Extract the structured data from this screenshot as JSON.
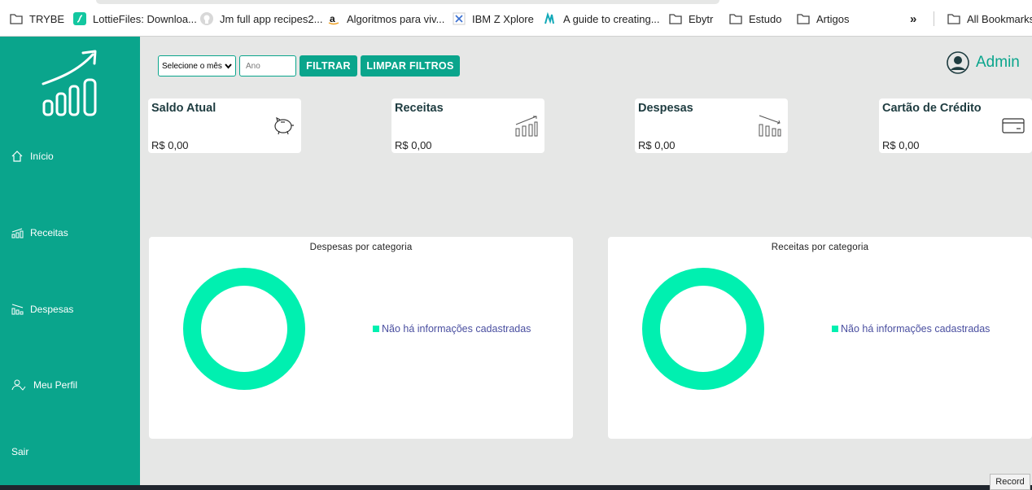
{
  "bookmarks": {
    "items": [
      {
        "label": "TRYBE",
        "icon": "folder-icon"
      },
      {
        "label": "LottieFiles: Downloa...",
        "icon": "lottiefiles-icon"
      },
      {
        "label": "Jm full app recipes2...",
        "icon": "github-icon"
      },
      {
        "label": "Algoritmos para viv...",
        "icon": "amazon-icon"
      },
      {
        "label": "IBM Z Xplore",
        "icon": "ibm-icon"
      },
      {
        "label": "A guide to creating...",
        "icon": "medium-icon"
      },
      {
        "label": "Ebytr",
        "icon": "folder-icon"
      },
      {
        "label": "Estudo",
        "icon": "folder-icon"
      },
      {
        "label": "Artigos",
        "icon": "folder-icon"
      }
    ],
    "more": "»",
    "all_bookmarks": "All Bookmarks"
  },
  "sidebar": {
    "items": [
      {
        "label": "Início",
        "icon": "home-icon"
      },
      {
        "label": "Receitas",
        "icon": "chart-up-icon"
      },
      {
        "label": "Despesas",
        "icon": "chart-down-icon"
      },
      {
        "label": "Meu Perfil",
        "icon": "user-icon"
      },
      {
        "label": "Sair",
        "icon": ""
      }
    ]
  },
  "filters": {
    "month_select": "Selecione o mês",
    "year_placeholder": "Ano",
    "filter_button": "FILTRAR",
    "clear_button": "LIMPAR FILTROS"
  },
  "user": {
    "name": "Admin"
  },
  "cards": [
    {
      "title": "Saldo Atual",
      "value": "R$ 0,00",
      "icon": "piggy-bank-icon"
    },
    {
      "title": "Receitas",
      "value": "R$ 0,00",
      "icon": "chart-up-icon"
    },
    {
      "title": "Despesas",
      "value": "R$ 0,00",
      "icon": "chart-down-icon"
    },
    {
      "title": "Cartão de Crédito",
      "value": "R$ 0,00",
      "icon": "credit-card-icon"
    }
  ],
  "charts": {
    "expenses": {
      "title": "Despesas por categoria",
      "legend": "Não há informações cadastradas"
    },
    "revenues": {
      "title": "Receitas por categoria",
      "legend": "Não há informações cadastradas"
    }
  },
  "colors": {
    "brand": "#0aa58c",
    "donut": "#00f0b0",
    "legend_text": "#4a4fa0"
  },
  "record_button": "Record"
}
